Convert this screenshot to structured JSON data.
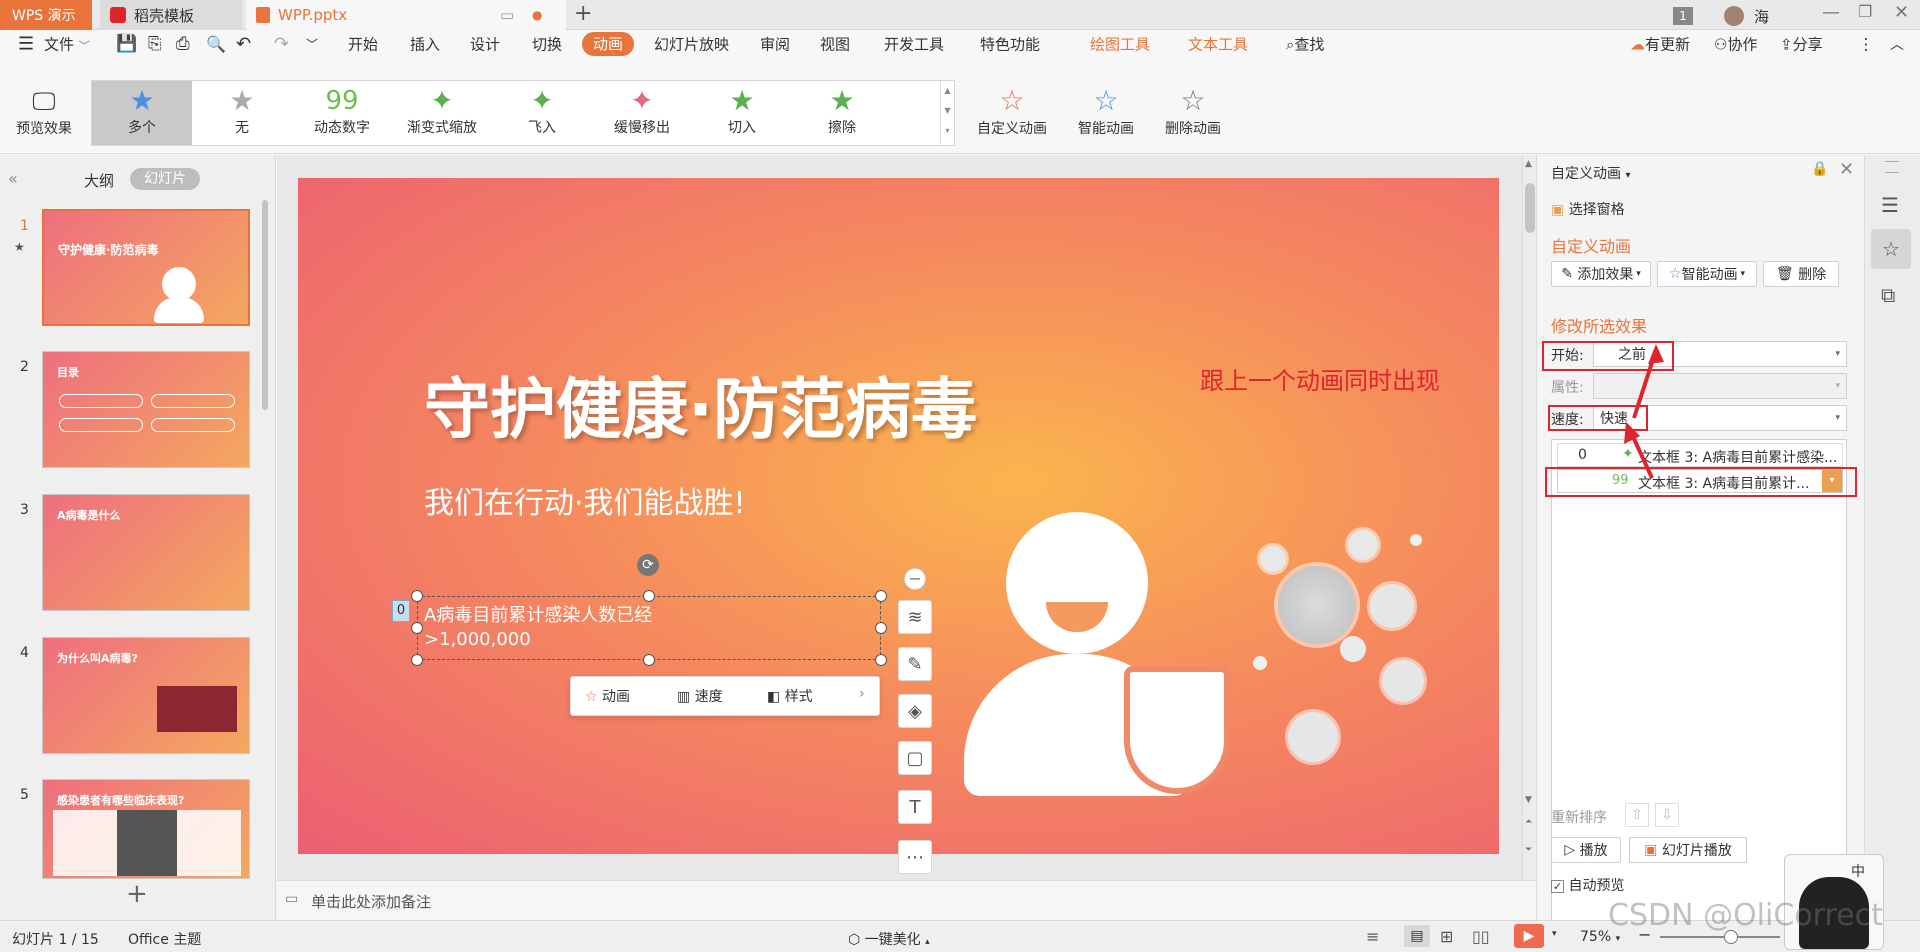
{
  "titlebar": {
    "app_tab": "WPS 演示",
    "template_tab": "稻壳模板",
    "doc_tab": "WPP.pptx",
    "user_badge": "1",
    "user_name": "海"
  },
  "menu": {
    "file": "文件",
    "items": [
      "开始",
      "插入",
      "设计",
      "切换",
      "动画",
      "幻灯片放映",
      "审阅",
      "视图",
      "开发工具",
      "特色功能"
    ],
    "active": "动画",
    "tools": [
      "绘图工具",
      "文本工具"
    ],
    "search": "查找",
    "update": "有更新",
    "collab": "协作",
    "share": "分享"
  },
  "ribbon": {
    "preview": "预览效果",
    "gallery": [
      {
        "label": "多个",
        "icon": "star-blue-icon"
      },
      {
        "label": "无",
        "icon": "star-gray-icon"
      },
      {
        "label": "动态数字",
        "icon": "number-99-icon"
      },
      {
        "label": "渐变式缩放",
        "icon": "star-zoom-icon"
      },
      {
        "label": "飞入",
        "icon": "star-fly-icon"
      },
      {
        "label": "缓慢移出",
        "icon": "star-slow-icon"
      },
      {
        "label": "切入",
        "icon": "star-cut-icon"
      },
      {
        "label": "擦除",
        "icon": "star-wipe-icon"
      }
    ],
    "custom": "自定义动画",
    "smart": "智能动画",
    "delete": "删除动画"
  },
  "leftpanel": {
    "tab_outline": "大纲",
    "tab_slides": "幻灯片",
    "slides": [
      {
        "num": "1",
        "title": "守护健康·防范病毒"
      },
      {
        "num": "2",
        "title": "目录"
      },
      {
        "num": "3",
        "title": "A病毒是什么"
      },
      {
        "num": "4",
        "title": "为什么叫A病毒?"
      },
      {
        "num": "5",
        "title": "感染患者有哪些临床表现?"
      }
    ]
  },
  "slide": {
    "title": "守护健康·防范病毒",
    "subtitle": "我们在行动·我们能战胜!",
    "textbox_line1": "A病毒目前累计感染人数已经",
    "textbox_line2": ">1,000,000",
    "textbox_index": "0",
    "annotation": "跟上一个动画同时出现",
    "toolbar": {
      "anim": "动画",
      "speed": "速度",
      "style": "样式"
    }
  },
  "notes": "单击此处添加备注",
  "rightpanel": {
    "header": "自定义动画",
    "select_pane": "选择窗格",
    "section1": "自定义动画",
    "add_effect": "添加效果",
    "smart_anim": "智能动画",
    "delete": "删除",
    "section2": "修改所选效果",
    "start_label": "开始:",
    "start_value": "之前",
    "prop_label": "属性:",
    "speed_label": "速度:",
    "speed_value": "快速",
    "anim_items": [
      {
        "index": "0",
        "text": "文本框 3: A病毒目前累计感染..."
      },
      {
        "index": "",
        "text": "文本框 3: A病毒目前累计..."
      }
    ],
    "reorder": "重新排序",
    "play": "播放",
    "slideshow": "幻灯片播放",
    "autopreview": "自动预览"
  },
  "status": {
    "slide_info": "幻灯片 1 / 15",
    "theme": "Office 主题",
    "beautify": "一键美化",
    "zoom": "75%",
    "watermark": "CSDN @OliCorrect"
  },
  "colors": {
    "accent": "#e8743b",
    "red": "#e0242e",
    "tool": "#e8743b"
  }
}
